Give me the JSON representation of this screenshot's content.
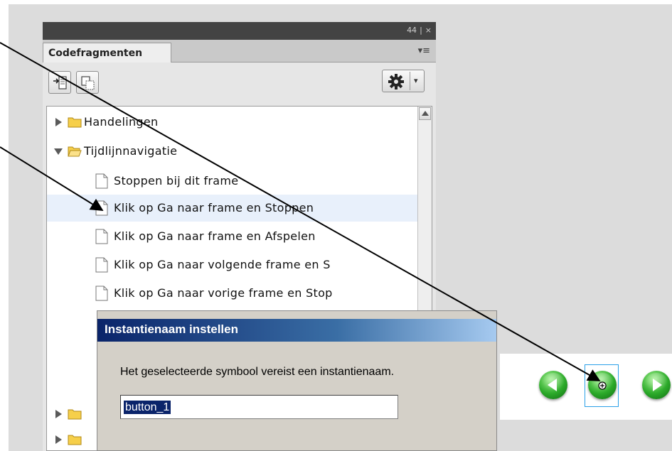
{
  "panel": {
    "tab_label": "Codefragmenten",
    "tab_menu_icon": "panel-menu-icon",
    "window_controls": [
      "44",
      "|",
      "×"
    ],
    "toolbar": {
      "insert_button_icon": "insert-code-icon",
      "copy_button_icon": "copy-to-clipboard-icon",
      "options_button_icon": "gear-icon"
    },
    "tree": [
      {
        "label": "Handelingen",
        "type": "folder",
        "expanded": false
      },
      {
        "label": "Tijdlijnnavigatie",
        "type": "folder",
        "expanded": true
      },
      {
        "label": "Stoppen bij dit frame",
        "type": "snippet"
      },
      {
        "label": "Klik op Ga naar frame en Stoppen",
        "type": "snippet",
        "selected": true
      },
      {
        "label": "Klik op Ga naar frame en Afspelen",
        "type": "snippet"
      },
      {
        "label": "Klik op Ga naar volgende frame en S",
        "type": "snippet"
      },
      {
        "label": "Klik op Ga naar vorige frame en Stop",
        "type": "snippet"
      }
    ]
  },
  "dialog": {
    "title": "Instantienaam instellen",
    "message": "Het geselecteerde symbool vereist een instantienaam.",
    "input_value": "button_1"
  },
  "stage": {
    "buttons": [
      "previous-button",
      "selected-button",
      "next-button"
    ],
    "accent": "#2aa0e8"
  },
  "colors": {
    "panel_header": "#434343",
    "dialog_title_start": "#0a246a",
    "selection_row": "#e8f0fb"
  }
}
